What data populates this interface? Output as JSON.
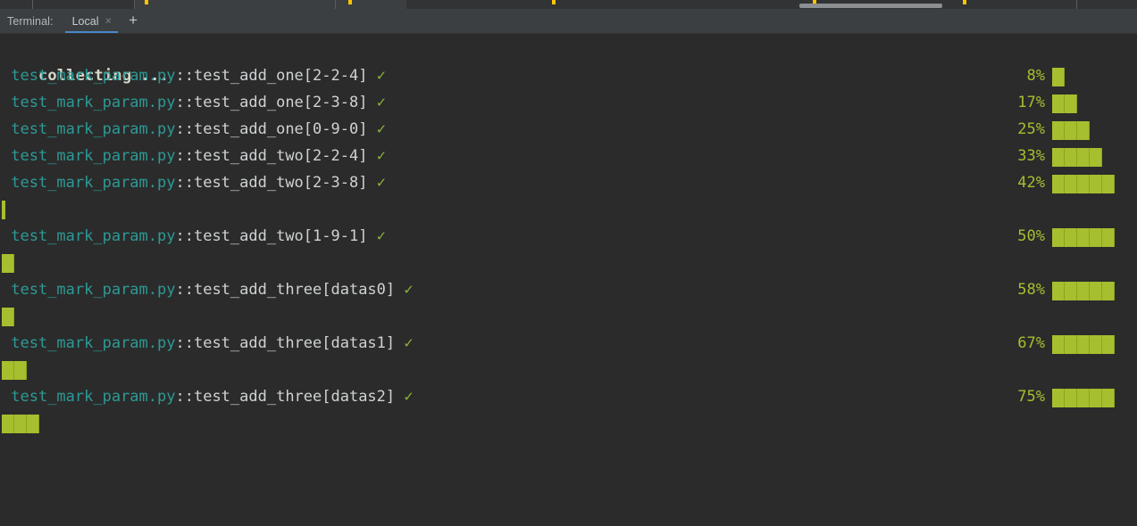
{
  "window": {
    "top_strip": {
      "warning_marks": [
        162,
        228,
        308,
        228
      ],
      "scrollbar": "horizontal-scrollbar"
    }
  },
  "terminal_tabs": {
    "label": "Terminal:",
    "tabs": [
      {
        "name": "Local",
        "close_icon": "×",
        "active": true
      }
    ],
    "new_tab_icon": "+"
  },
  "terminal": {
    "heading": "collecting ...",
    "file_name": "test_mark_param.py",
    "separator": "::",
    "pass_mark": "✓",
    "colors": {
      "background": "#2b2b2b",
      "file": "#2c9a96",
      "test": "#cfd2d4",
      "pass": "#8fb33a",
      "percent": "#a6bf2f",
      "bar": "#a6bf2f",
      "tabbar": "#3c3f41",
      "tab_underline": "#4a88c7"
    },
    "rows": [
      {
        "test": "test_add_one[2-2-4]",
        "percent": "8%",
        "blocks": 1,
        "overflow_blocks": 0,
        "overflow_partial": false
      },
      {
        "test": "test_add_one[2-3-8]",
        "percent": "17%",
        "blocks": 2,
        "overflow_blocks": 0,
        "overflow_partial": false
      },
      {
        "test": "test_add_one[0-9-0]",
        "percent": "25%",
        "blocks": 3,
        "overflow_blocks": 0,
        "overflow_partial": false
      },
      {
        "test": "test_add_two[2-2-4]",
        "percent": "33%",
        "blocks": 4,
        "overflow_blocks": 0,
        "overflow_partial": false
      },
      {
        "test": "test_add_two[2-3-8]",
        "percent": "42%",
        "blocks": 5,
        "overflow_blocks": 0,
        "overflow_partial": true
      },
      {
        "test": "test_add_two[1-9-1]",
        "percent": "50%",
        "blocks": 5,
        "overflow_blocks": 1,
        "overflow_partial": false
      },
      {
        "test": "test_add_three[datas0]",
        "percent": "58%",
        "blocks": 5,
        "overflow_blocks": 1,
        "overflow_partial": false
      },
      {
        "test": "test_add_three[datas1]",
        "percent": "67%",
        "blocks": 5,
        "overflow_blocks": 2,
        "overflow_partial": false
      },
      {
        "test": "test_add_three[datas2]",
        "percent": "75%",
        "blocks": 5,
        "overflow_blocks": 3,
        "overflow_partial": false
      }
    ]
  }
}
